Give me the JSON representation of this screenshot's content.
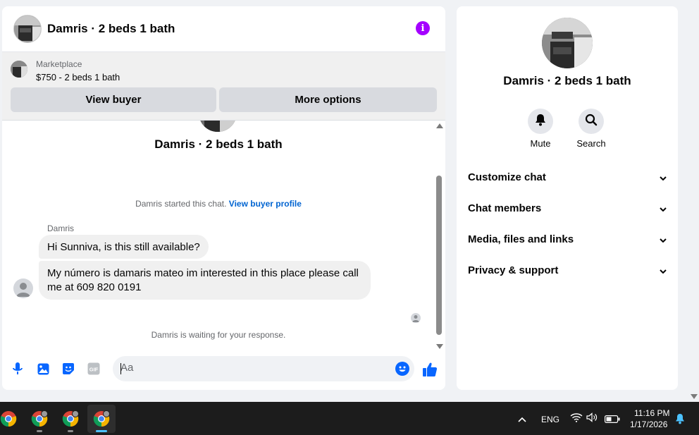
{
  "chat": {
    "title": "Damris · 2 beds 1 bath",
    "marketplace": {
      "label": "Marketplace",
      "price_title": "$750 - 2 beds 1 bath",
      "view_buyer": "View buyer",
      "more_options": "More options"
    },
    "conversation_title": "Damris · 2 beds 1 bath",
    "started_text": "Damris started this chat.",
    "view_buyer_profile": "View buyer profile",
    "sender_name": "Damris",
    "messages": [
      "Hi Sunniva, is this still available?",
      "My número is damaris  mateo im interested  in this place please call me at 609 820 0191"
    ],
    "waiting_text": "Damris is waiting for your response.",
    "composer_placeholder": "Aa"
  },
  "details": {
    "title": "Damris · 2 beds 1 bath",
    "actions": [
      "Mute",
      "Search"
    ],
    "sections": [
      "Customize chat",
      "Chat members",
      "Media, files and links",
      "Privacy & support"
    ]
  },
  "taskbar": {
    "language": "ENG",
    "time": "11:16 PM",
    "date": "1/17/2026"
  },
  "colors": {
    "accent": "#0866ff",
    "info": "#a400ff",
    "link": "#0064d1"
  },
  "icons": [
    "info-icon",
    "mic-icon",
    "image-icon",
    "sticker-icon",
    "gif-icon",
    "emoji-icon",
    "thumbs-up-icon",
    "bell-icon",
    "search-icon",
    "chevron-down-icon",
    "chrome-icon",
    "wifi-icon",
    "volume-icon",
    "battery-icon",
    "notification-bell-icon"
  ]
}
